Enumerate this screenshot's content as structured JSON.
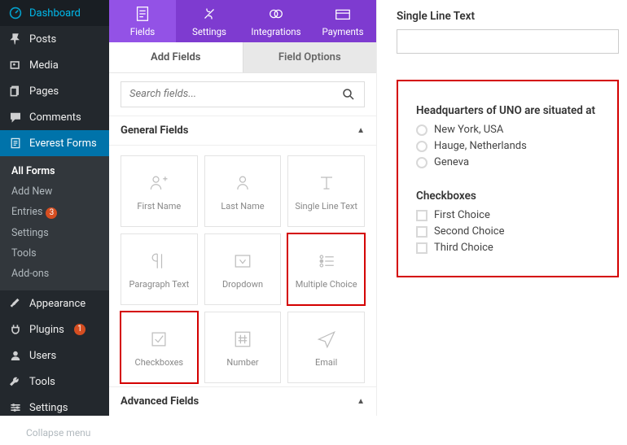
{
  "wp_sidebar": {
    "dashboard": "Dashboard",
    "posts": "Posts",
    "media": "Media",
    "pages": "Pages",
    "comments": "Comments",
    "everest": "Everest Forms",
    "sub": {
      "all_forms": "All Forms",
      "add_new": "Add New",
      "entries": "Entries",
      "entries_badge": "3",
      "settings": "Settings",
      "tools": "Tools",
      "addons": "Add-ons"
    },
    "appearance": "Appearance",
    "plugins": "Plugins",
    "plugins_badge": "1",
    "users": "Users",
    "tools": "Tools",
    "settings": "Settings",
    "collapse": "Collapse menu"
  },
  "toolbar": {
    "fields": "Fields",
    "settings": "Settings",
    "integrations": "Integrations",
    "payments": "Payments"
  },
  "tabs": {
    "add": "Add Fields",
    "options": "Field Options"
  },
  "search": {
    "placeholder": "Search fields..."
  },
  "sections": {
    "general": "General Fields",
    "advanced": "Advanced Fields"
  },
  "tiles": {
    "first_name": "First Name",
    "last_name": "Last Name",
    "single_line": "Single Line Text",
    "paragraph": "Paragraph Text",
    "dropdown": "Dropdown",
    "multiple_choice": "Multiple Choice",
    "checkboxes": "Checkboxes",
    "number": "Number",
    "email": "Email"
  },
  "preview": {
    "single_line": {
      "label": "Single Line Text"
    },
    "radio": {
      "label": "Headquarters of UNO are situated at",
      "opts": [
        "New York, USA",
        "Hauge, Netherlands",
        "Geneva"
      ]
    },
    "check": {
      "label": "Checkboxes",
      "opts": [
        "First Choice",
        "Second Choice",
        "Third Choice"
      ]
    }
  }
}
